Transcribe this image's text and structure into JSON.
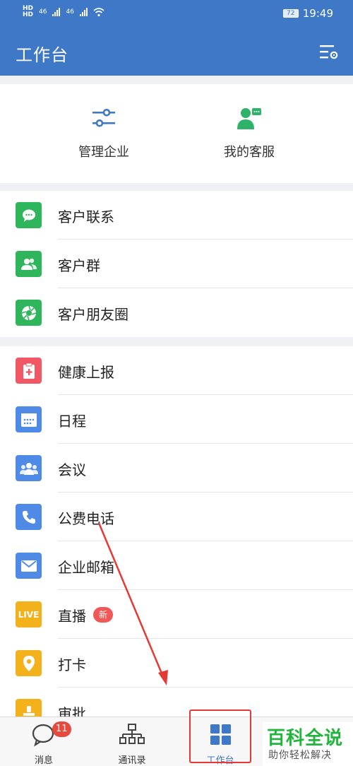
{
  "status": {
    "net_left": "46",
    "net_left2": "46",
    "battery": "72",
    "time": "19:49"
  },
  "header": {
    "title": "工作台",
    "settings_icon": "settings-list-icon"
  },
  "quick": [
    {
      "label": "管理企业",
      "icon": "sliders-icon",
      "color": "#3f78c6"
    },
    {
      "label": "我的客服",
      "icon": "customer-service-icon",
      "color": "#2fb36b"
    }
  ],
  "group1": [
    {
      "label": "客户联系",
      "icon": "chat-bubble-icon",
      "color": "#2fb55c"
    },
    {
      "label": "客户群",
      "icon": "users-icon",
      "color": "#2fb55c"
    },
    {
      "label": "客户朋友圈",
      "icon": "aperture-icon",
      "color": "#2fb55c"
    }
  ],
  "group2": [
    {
      "label": "健康上报",
      "icon": "medical-clipboard-icon",
      "color": "#f25765"
    },
    {
      "label": "日程",
      "icon": "calendar-icon",
      "color": "#4f8be6"
    },
    {
      "label": "会议",
      "icon": "meeting-people-icon",
      "color": "#4f8be6"
    },
    {
      "label": "公费电话",
      "icon": "phone-icon",
      "color": "#4f8be6"
    },
    {
      "label": "企业邮箱",
      "icon": "mail-icon",
      "color": "#4f8be6"
    },
    {
      "label": "直播",
      "icon": "live-icon",
      "color": "#f3b21c",
      "icon_text": "LIVE",
      "badge": "新"
    },
    {
      "label": "打卡",
      "icon": "location-pin-icon",
      "color": "#f3b21c"
    },
    {
      "label": "审批",
      "icon": "stamp-icon",
      "color": "#f3b21c"
    }
  ],
  "nav": [
    {
      "label": "消息",
      "icon": "message-icon",
      "unread": "11"
    },
    {
      "label": "通讯录",
      "icon": "org-chart-icon"
    },
    {
      "label": "工作台",
      "icon": "grid-icon",
      "active": true
    }
  ],
  "watermark": {
    "line1": "百科全说",
    "line2": "助你轻松解决"
  },
  "colors": {
    "brand": "#3f78c6",
    "highlight": "#e53935"
  }
}
